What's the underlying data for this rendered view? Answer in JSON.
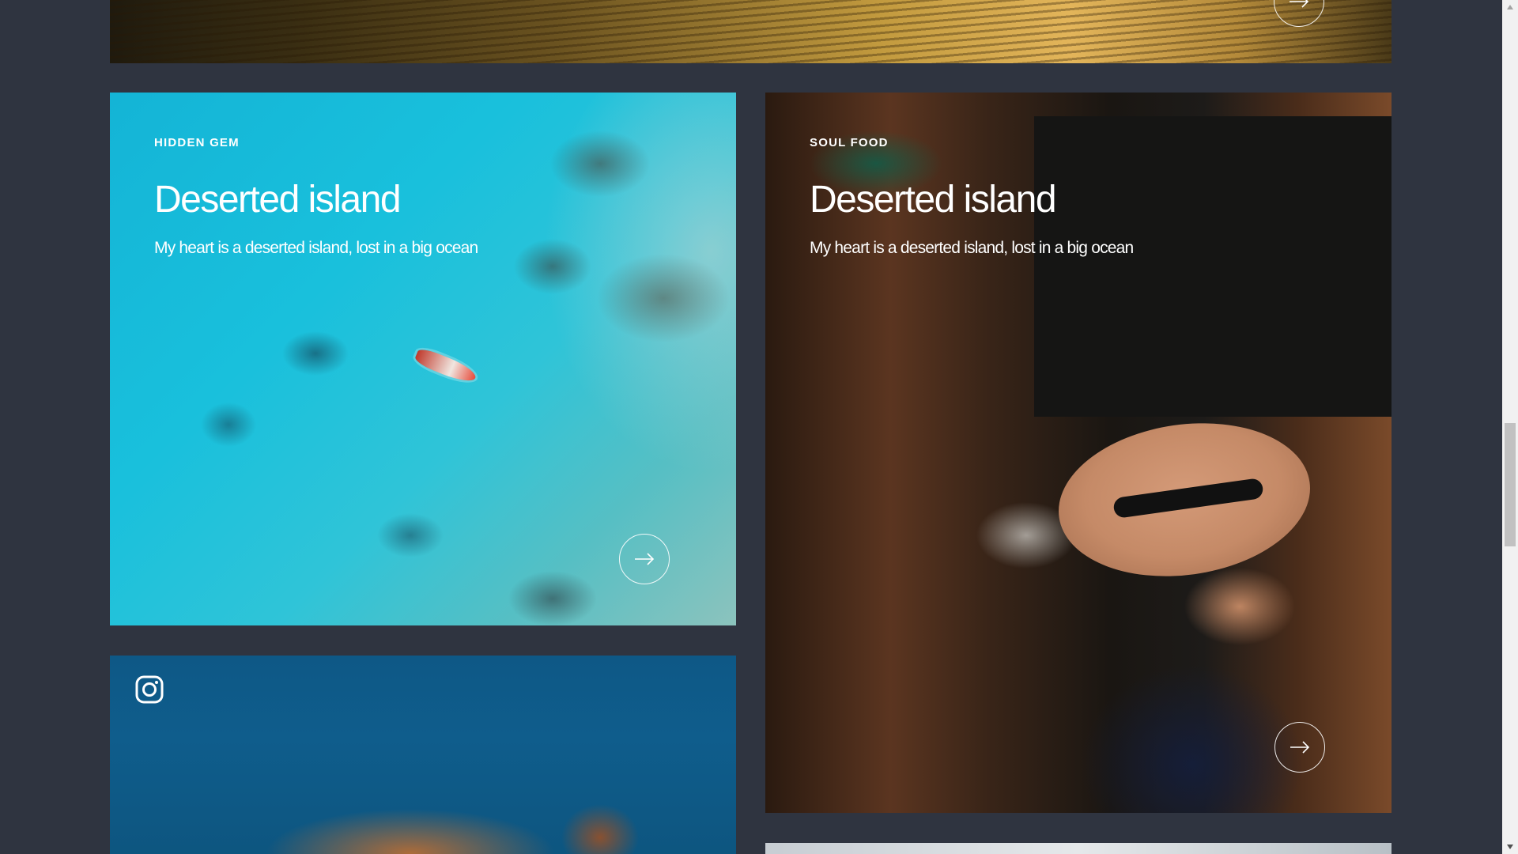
{
  "cards": {
    "top": {
      "image": "sunset-water"
    },
    "ocean": {
      "label": "HIDDEN GEM",
      "title": "Deserted island",
      "subtitle": "My heart is a deserted island, lost in a big ocean",
      "image": "aerial-ocean-boat"
    },
    "cafe": {
      "label": "SOUL FOOD",
      "title": "Deserted island",
      "subtitle": "My heart is a deserted island, lost in a big ocean",
      "image": "cafe-people-hat"
    },
    "turtle": {
      "icon": "instagram-icon",
      "image": "sea-turtle"
    },
    "bottom": {
      "image": "light-photo"
    }
  },
  "icons": {
    "arrow": "arrow-right-icon",
    "instagram": "instagram-icon"
  },
  "colors": {
    "page_background": "#2f3440",
    "text": "#ffffff",
    "scrollbar_track": "#f1f1f1",
    "scrollbar_thumb": "#c1c1c1"
  }
}
